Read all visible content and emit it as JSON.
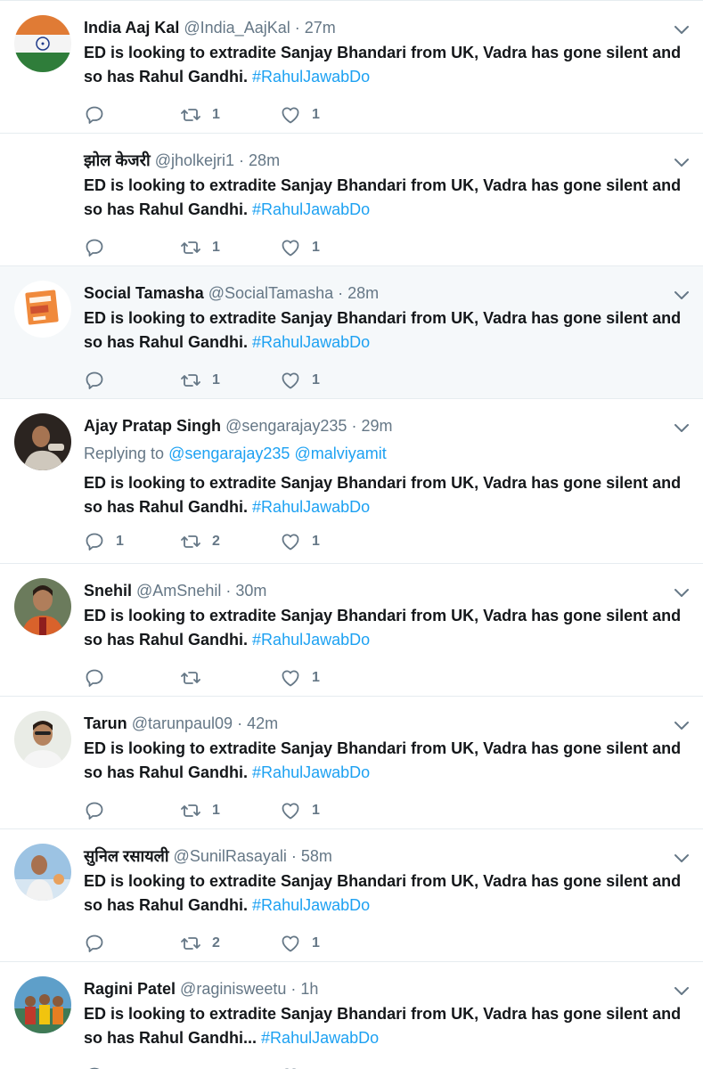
{
  "tweets": [
    {
      "name": "India Aaj Kal",
      "handle": "@India_AajKal",
      "time": "27m",
      "text": "ED is looking to extradite Sanjay Bhandari from UK, Vadra has gone silent and so has Rahul Gandhi.",
      "hashtag": "#RahulJawabDo",
      "replies": "",
      "retweets": "1",
      "likes": "1"
    },
    {
      "name": "झोल केजरी",
      "handle": "@jholkejri1",
      "time": "28m",
      "text": "ED is looking to extradite Sanjay Bhandari from UK, Vadra has gone silent and so has Rahul Gandhi.",
      "hashtag": "#RahulJawabDo",
      "replies": "",
      "retweets": "1",
      "likes": "1"
    },
    {
      "name": "Social Tamasha",
      "handle": "@SocialTamasha",
      "time": "28m",
      "text": "ED is looking to extradite Sanjay Bhandari from UK, Vadra has gone silent and so has Rahul Gandhi.",
      "hashtag": "#RahulJawabDo",
      "replies": "",
      "retweets": "1",
      "likes": "1"
    },
    {
      "name": "Ajay Pratap Singh",
      "handle": "@sengarajay235",
      "time": "29m",
      "replying_prefix": "Replying to",
      "replying_to_1": "@sengarajay235",
      "replying_to_2": "@malviyamit",
      "text": "ED is looking to extradite Sanjay Bhandari from UK, Vadra has gone silent and so has Rahul Gandhi.",
      "hashtag": "#RahulJawabDo",
      "replies": "1",
      "retweets": "2",
      "likes": "1"
    },
    {
      "name": "Snehil",
      "handle": "@AmSnehil",
      "time": "30m",
      "text": "ED is looking to extradite Sanjay Bhandari from UK, Vadra has gone silent and so has Rahul Gandhi.",
      "hashtag": "#RahulJawabDo",
      "replies": "",
      "retweets": "",
      "likes": "1"
    },
    {
      "name": "Tarun",
      "handle": "@tarunpaul09",
      "time": "42m",
      "text": "ED is looking to extradite Sanjay Bhandari from UK, Vadra has gone silent and so has Rahul Gandhi.",
      "hashtag": "#RahulJawabDo",
      "replies": "",
      "retweets": "1",
      "likes": "1"
    },
    {
      "name": "सुनिल रसायली",
      "handle": "@SunilRasayali",
      "time": "58m",
      "text": "ED is looking to extradite Sanjay Bhandari from UK, Vadra has gone silent and so has Rahul Gandhi.",
      "hashtag": "#RahulJawabDo",
      "replies": "",
      "retweets": "2",
      "likes": "1"
    },
    {
      "name": "Ragini Patel",
      "handle": "@raginisweetu",
      "time": "1h",
      "text": "ED is looking to extradite Sanjay Bhandari from UK, Vadra has gone silent and so has Rahul Gandhi...",
      "hashtag": "#RahulJawabDo",
      "replies": "",
      "retweets": "",
      "likes": ""
    }
  ],
  "colors": {
    "name": "#14171a",
    "secondary": "#657786",
    "link": "#1da1f2",
    "divider": "#e6ecf0",
    "hover_background": "#f5f8fa"
  },
  "icons": {
    "reply": "reply-icon",
    "retweet": "retweet-icon",
    "like": "heart-icon",
    "caret": "chevron-down-icon"
  }
}
